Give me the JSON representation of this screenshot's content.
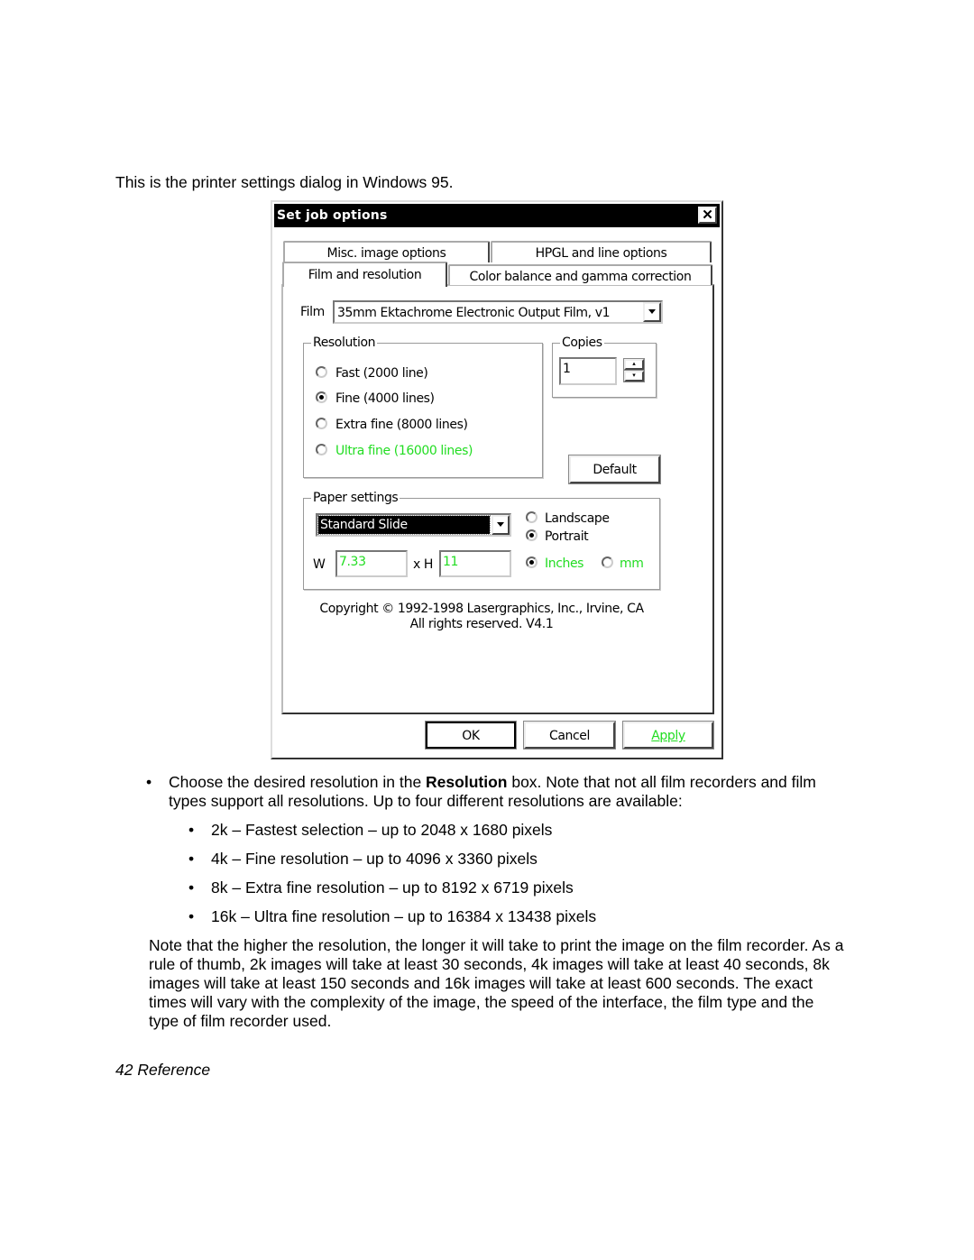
{
  "intro": "This is the printer settings dialog in Windows 95.",
  "dialog": {
    "title": "Set job options",
    "tabs_back": [
      "Misc. image options",
      "HPGL and line options"
    ],
    "tabs_front": [
      "Film and resolution",
      "Color balance and gamma correction"
    ],
    "active_tab": "Film and resolution",
    "film_label": "Film",
    "film_value": "35mm Ektachrome Electronic Output Film, v1",
    "resolution": {
      "legend": "Resolution",
      "options": [
        "Fast (2000 line)",
        "Fine (4000 lines)",
        "Extra fine (8000 lines)",
        "Ultra fine (16000 lines)"
      ],
      "selected": "Fine (4000 lines)"
    },
    "copies": {
      "legend": "Copies",
      "value": "1"
    },
    "default_button": "Default",
    "paper": {
      "legend": "Paper settings",
      "size_value": "Standard Slide",
      "orientation": [
        "Landscape",
        "Portrait"
      ],
      "orientation_selected": "Portrait",
      "w_label": "W",
      "w_value": "7.33",
      "h_label": "x H",
      "h_value": "11",
      "units": [
        "Inches",
        "mm"
      ],
      "units_selected": "Inches"
    },
    "copyright_line1": "Copyright © 1992-1998 Lasergraphics, Inc., Irvine, CA",
    "copyright_line2": "All rights reserved.  V4.1",
    "ok": "OK",
    "cancel": "Cancel",
    "apply": "Apply",
    "close_icon": "close-x",
    "highlight_color": "#22dd22"
  },
  "bullet": {
    "pre": "Choose the desired resolution in the ",
    "bold": "Resolution",
    "post": " box. Note that not all film recorders and film types support all resolutions. Up to four different resolutions are available:"
  },
  "subbullets": [
    "2k – Fastest selection – up to 2048 x 1680 pixels",
    "4k – Fine resolution – up to 4096 x 3360 pixels",
    "8k – Extra fine resolution – up to 8192 x 6719 pixels",
    "16k – Ultra fine resolution – up to 16384 x 13438 pixels"
  ],
  "note": "Note that the higher the resolution, the longer it will take to print the image on the film recorder. As a rule of thumb, 2k images will take at least 30 seconds, 4k images will take at least 40 seconds, 8k images will take at least 150 seconds and 16k images will take at least 600 seconds. The exact times will vary with the complexity of the image, the speed of the interface, the film type and the type of film recorder used.",
  "footer": "42 Reference"
}
